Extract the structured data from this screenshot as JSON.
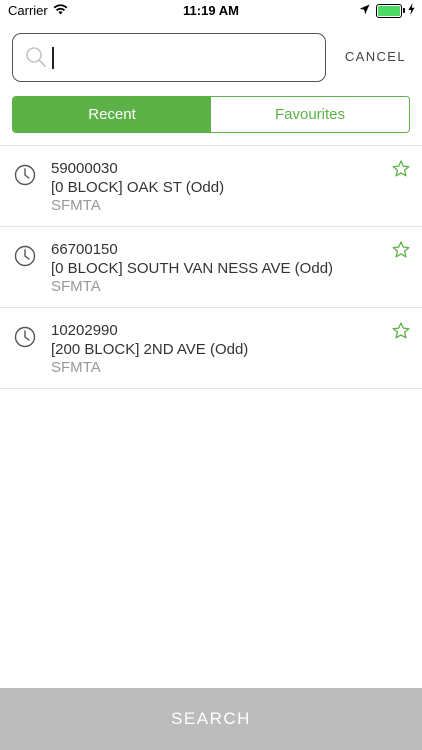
{
  "status_bar": {
    "carrier": "Carrier",
    "time": "11:19 AM"
  },
  "search": {
    "placeholder": "",
    "value": "",
    "cancel_label": "CANCEL"
  },
  "tabs": [
    {
      "label": "Recent",
      "active": true
    },
    {
      "label": "Favourites",
      "active": false
    }
  ],
  "recent_items": [
    {
      "id": "59000030",
      "address": "[0 BLOCK] OAK ST (Odd)",
      "agency": "SFMTA"
    },
    {
      "id": "66700150",
      "address": "[0 BLOCK] SOUTH VAN NESS AVE (Odd)",
      "agency": "SFMTA"
    },
    {
      "id": "10202990",
      "address": "[200 BLOCK] 2ND AVE (Odd)",
      "agency": "SFMTA"
    }
  ],
  "bottom": {
    "search_label": "SEARCH"
  },
  "colors": {
    "accent": "#5cb247",
    "search_button_bg": "#bcbcbc",
    "battery": "#4cd964"
  }
}
